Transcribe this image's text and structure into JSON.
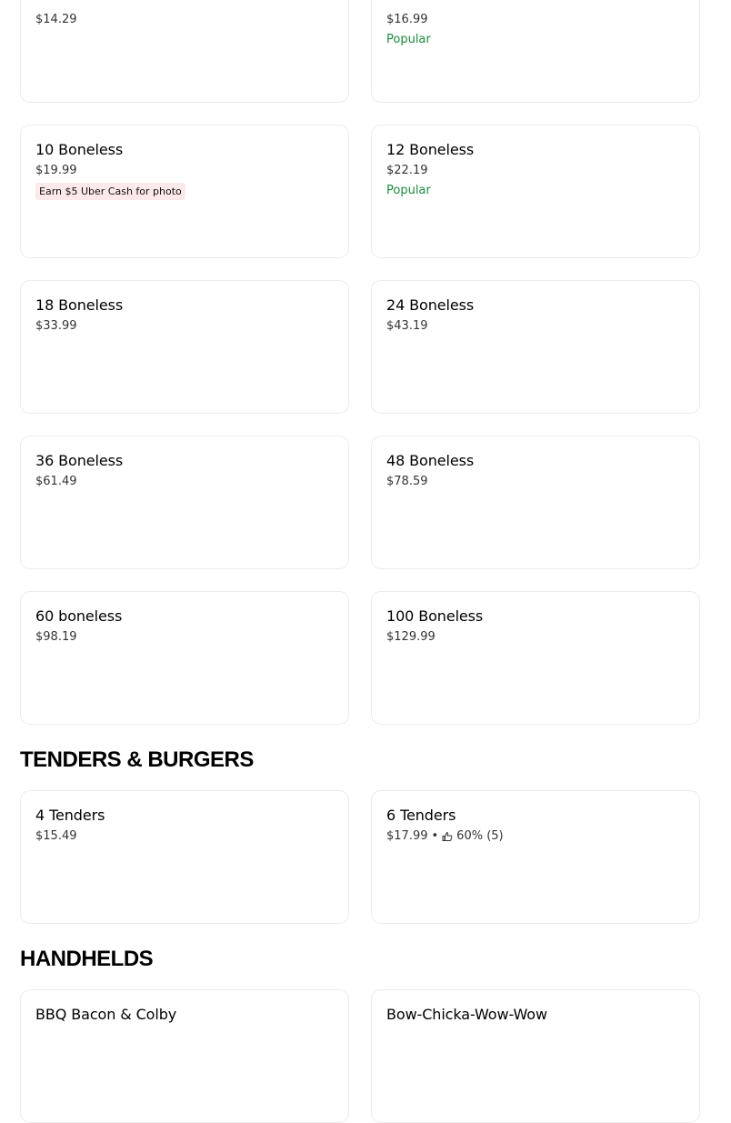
{
  "top_row": {
    "left": {
      "price": "$14.29"
    },
    "right": {
      "price": "$16.99",
      "tag": "Popular"
    }
  },
  "boneless_items": [
    {
      "name": "10 Boneless",
      "price": "$19.99",
      "tag": "Earn $5 Uber Cash for photo"
    },
    {
      "name": "12 Boneless",
      "price": "$22.19",
      "tag": "Popular"
    },
    {
      "name": "18 Boneless",
      "price": "$33.99"
    },
    {
      "name": "24 Boneless",
      "price": "$43.19"
    },
    {
      "name": "36 Boneless",
      "price": "$61.49"
    },
    {
      "name": "48 Boneless",
      "price": "$78.59"
    },
    {
      "name": "60 boneless",
      "price": "$98.19"
    },
    {
      "name": "100 Boneless",
      "price": "$129.99"
    }
  ],
  "sections": {
    "tenders_title": "TENDERS & BURGERS",
    "handhelds_title": "HANDHELDS"
  },
  "tenders_items": [
    {
      "name": "4 Tenders",
      "price": "$15.49"
    },
    {
      "name": "6 Tenders",
      "price": "$17.99",
      "separator": "•",
      "rating": "60% (5)"
    }
  ],
  "handhelds_items": [
    {
      "name": "BBQ Bacon & Colby"
    },
    {
      "name": "Bow-Chicka-Wow-Wow"
    }
  ],
  "colors": {
    "popular": "#1f8a3e",
    "earn_bg": "#fde9e9",
    "card_border": "#ebebeb"
  },
  "icons": {
    "rating": "thumbs-up-icon"
  }
}
